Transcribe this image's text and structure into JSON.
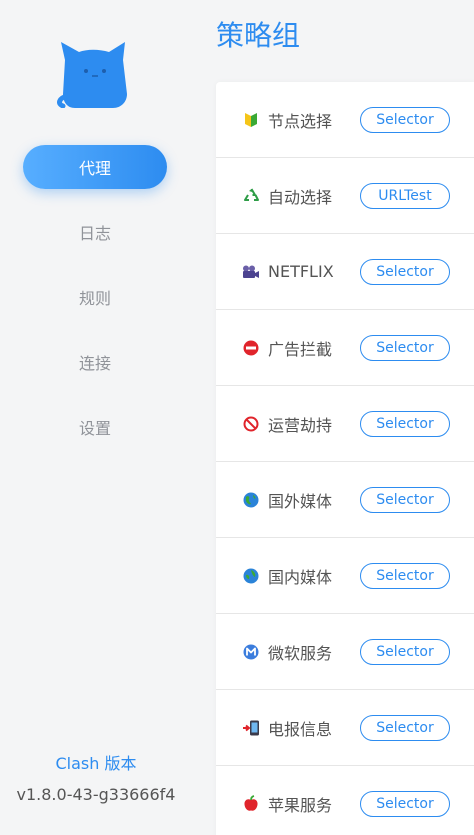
{
  "sidebar": {
    "items": [
      {
        "label": "代理",
        "active": true
      },
      {
        "label": "日志",
        "active": false
      },
      {
        "label": "规则",
        "active": false
      },
      {
        "label": "连接",
        "active": false
      },
      {
        "label": "设置",
        "active": false
      }
    ],
    "version_label": "Clash 版本",
    "version_value": "v1.8.0-43-g33666f4"
  },
  "main": {
    "title": "策略组",
    "groups": [
      {
        "name": "节点选择",
        "type": "Selector",
        "icon": "beginner-badge-icon"
      },
      {
        "name": "自动选择",
        "type": "URLTest",
        "icon": "recycle-icon"
      },
      {
        "name": "NETFLIX",
        "type": "Selector",
        "icon": "movie-camera-icon"
      },
      {
        "name": "广告拦截",
        "type": "Selector",
        "icon": "no-entry-icon"
      },
      {
        "name": "运营劫持",
        "type": "Selector",
        "icon": "prohibited-icon"
      },
      {
        "name": "国外媒体",
        "type": "Selector",
        "icon": "globe-icon"
      },
      {
        "name": "国内媒体",
        "type": "Selector",
        "icon": "globe-icon"
      },
      {
        "name": "微软服务",
        "type": "Selector",
        "icon": "m-badge-icon"
      },
      {
        "name": "电报信息",
        "type": "Selector",
        "icon": "phone-arrow-icon"
      },
      {
        "name": "苹果服务",
        "type": "Selector",
        "icon": "apple-icon"
      }
    ]
  },
  "colors": {
    "accent": "#2d8cf0",
    "background": "#f4f5f6",
    "text": "#545454",
    "muted": "#909399"
  }
}
